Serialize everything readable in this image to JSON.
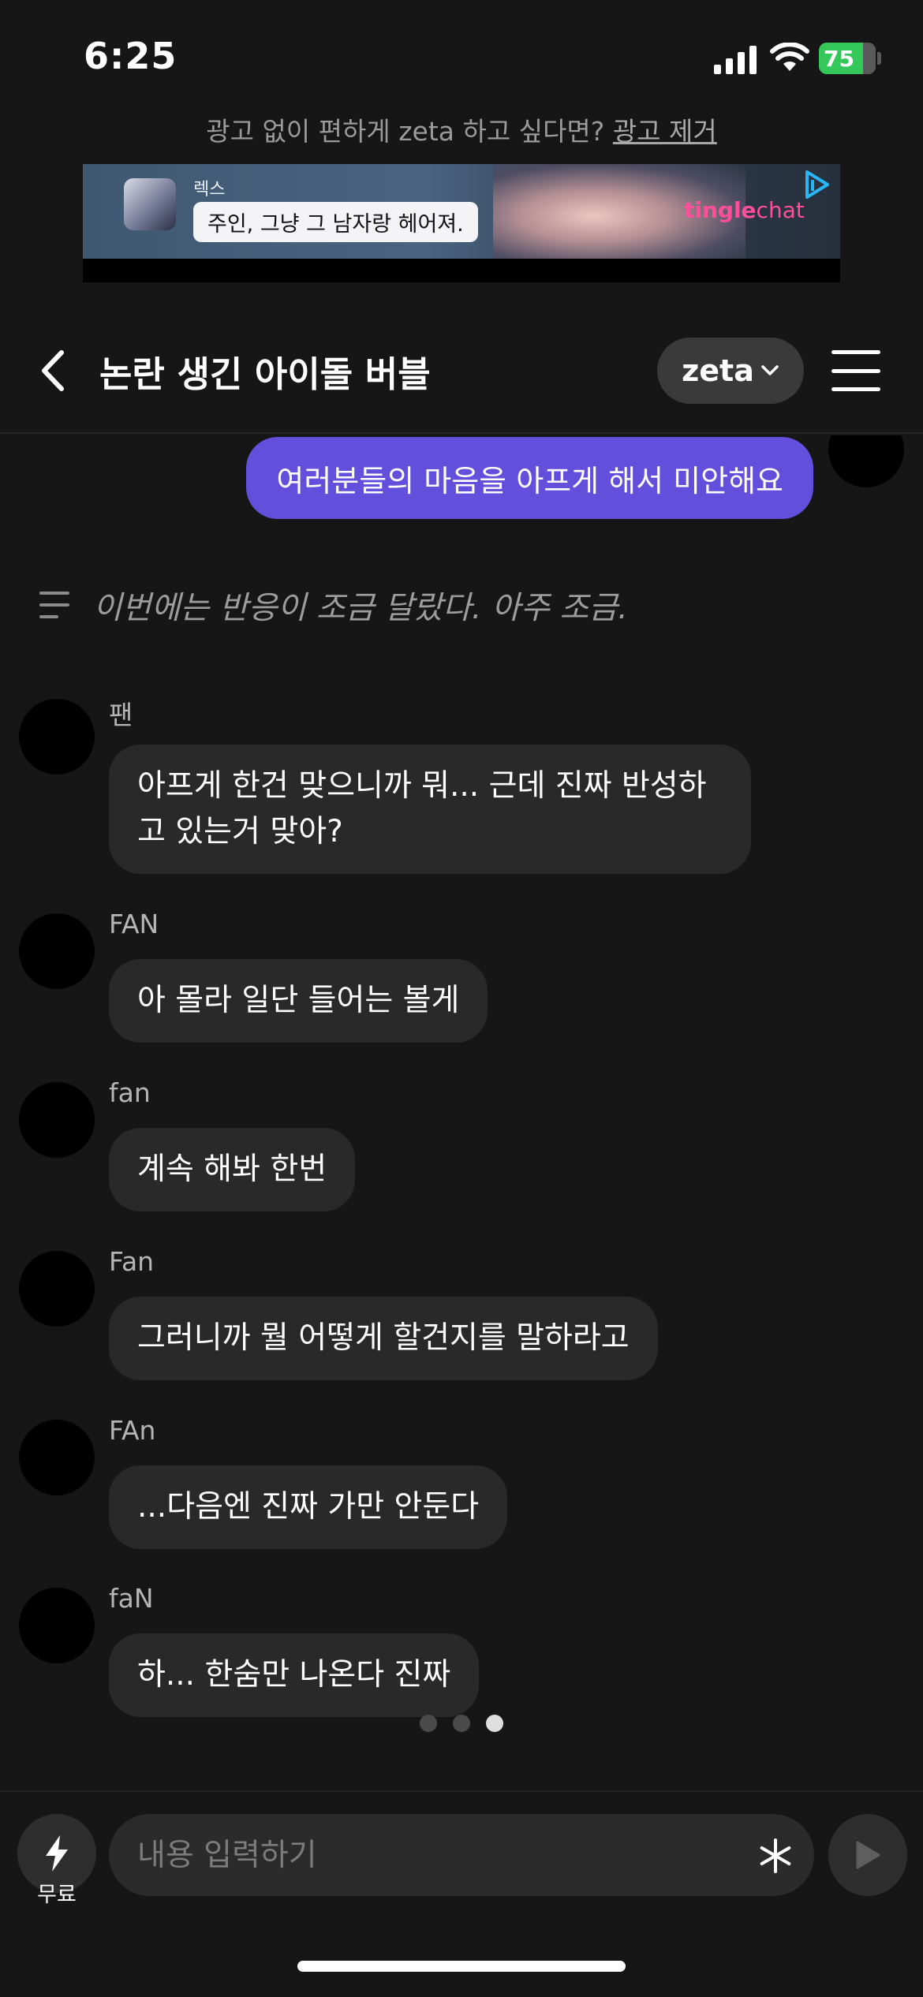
{
  "status_bar": {
    "time": "6:25",
    "battery": "75"
  },
  "ad": {
    "prompt_text": "광고 없이 편하게 zeta 하고 싶다면?",
    "remove_link": "광고 제거",
    "banner": {
      "character_name": "렉스",
      "bubble_text": "주인, 그냥 그 남자랑 헤어져.",
      "brand_bold": "tingle",
      "brand_light": "chat"
    }
  },
  "header": {
    "title": "논란 생긴 아이돌 버블",
    "model_label": "zeta"
  },
  "chat": {
    "my_message": "여러분들의 마음을 아프게 해서 미안해요",
    "narration": "이번에는 반응이 조금 달랐다. 아주 조금.",
    "messages": [
      {
        "name": "팬",
        "text": "아프게 한건 맞으니까 뭐... 근데 진짜 반성하고 있는거 맞아?"
      },
      {
        "name": "FAN",
        "text": "아 몰라 일단 들어는 볼게"
      },
      {
        "name": "fan",
        "text": "계속 해봐 한번"
      },
      {
        "name": "Fan",
        "text": "그러니까 뭘 어떻게 할건지를 말하라고"
      },
      {
        "name": "FAn",
        "text": "...다음엔 진짜 가만 안둔다"
      },
      {
        "name": "faN",
        "text": "하... 한숨만 나온다 진짜"
      }
    ]
  },
  "input": {
    "boost_label": "무료",
    "placeholder": "내용 입력하기"
  },
  "colors": {
    "background": "#161616",
    "my_bubble": "#6250dc",
    "other_bubble": "#292929",
    "battery": "#34c759"
  },
  "icons": {
    "back": "chevron-left-icon",
    "model_dropdown": "chevron-down-icon",
    "menu": "hamburger-icon",
    "narration": "text-lines-icon",
    "boost": "lightning-bolt-icon",
    "asterisk": "asterisk-icon",
    "send": "play-triangle-icon"
  }
}
